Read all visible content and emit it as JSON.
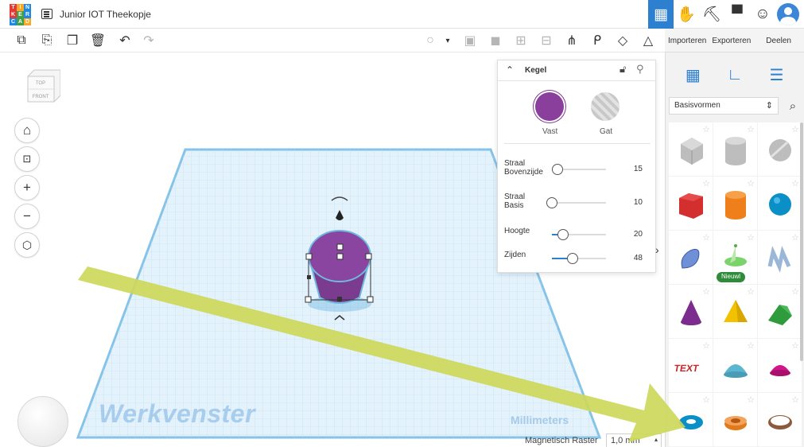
{
  "app": {
    "logo_letters": [
      "T",
      "I",
      "N",
      "K",
      "E",
      "R",
      "C",
      "A",
      "D"
    ],
    "logo_colors": [
      "#e53935",
      "#f9a825",
      "#1e88e5",
      "#e53935",
      "#43a047",
      "#1e88e5",
      "#1e88e5",
      "#43a047",
      "#f9a825"
    ],
    "design_title": "Junior IOT Theekopje"
  },
  "topbar_right": {
    "items": [
      {
        "name": "grid-view-icon",
        "glyph": "▦"
      },
      {
        "name": "hand-icon",
        "glyph": "✋"
      },
      {
        "name": "pickaxe-icon",
        "glyph": "⛏"
      },
      {
        "name": "bricks-icon",
        "glyph": "▀"
      },
      {
        "name": "add-user-icon",
        "glyph": "👤"
      }
    ]
  },
  "toolbar": {
    "left": [
      {
        "name": "copy-icon",
        "glyph": "⧉"
      },
      {
        "name": "paste-icon",
        "glyph": "📋"
      },
      {
        "name": "duplicate-icon",
        "glyph": "❐"
      },
      {
        "name": "trash-icon",
        "glyph": "🗑"
      },
      {
        "name": "undo-icon",
        "glyph": "↶"
      },
      {
        "name": "redo-icon",
        "glyph": "↷"
      }
    ],
    "right": [
      {
        "name": "bulb-icon",
        "glyph": "💡"
      },
      {
        "name": "caret-down-icon",
        "glyph": "▾"
      },
      {
        "name": "group-icon",
        "glyph": "▣"
      },
      {
        "name": "ungroup-icon",
        "glyph": "◨"
      },
      {
        "name": "align-icon",
        "glyph": "⊟"
      },
      {
        "name": "distribute-icon",
        "glyph": "≡"
      },
      {
        "name": "mirror-icon",
        "glyph": "⋔"
      },
      {
        "name": "cruise-icon",
        "glyph": "ᑭ"
      },
      {
        "name": "workplane-icon",
        "glyph": "◇"
      },
      {
        "name": "ruler-drop-icon",
        "glyph": "⚠"
      }
    ],
    "right_tabs": [
      "Importeren",
      "Exporteren",
      "Deelen"
    ]
  },
  "viewcube": {
    "top": "TOP",
    "front": "FRONT"
  },
  "workspace": {
    "label": "Werkvenster",
    "units": "Millimeters",
    "snap_label": "Magnetisch Raster",
    "snap_value": "1,0 mm"
  },
  "inspector": {
    "title": "Kegel",
    "solid_label": "Vast",
    "hole_label": "Gat",
    "solid_color": "#8a3f9c",
    "props": [
      {
        "label_1": "Straal",
        "label_2": "Bovenzijde",
        "value": "15",
        "fraction": 0.1
      },
      {
        "label_1": "Straal",
        "label_2": "Basis",
        "value": "10",
        "fraction": 0.0
      },
      {
        "label_1": "Hoogte",
        "label_2": "",
        "value": "20",
        "fraction": 0.2
      },
      {
        "label_1": "Zijden",
        "label_2": "",
        "value": "48",
        "fraction": 0.38
      }
    ]
  },
  "shapes_panel": {
    "category": "Basisvormen",
    "new_badge": "Nieuwl",
    "shapes": [
      {
        "name": "box-hole",
        "color": "#bdbdbd"
      },
      {
        "name": "cylinder-hole",
        "color": "#bdbdbd"
      },
      {
        "name": "sphere-hole",
        "color": "#bdbdbd"
      },
      {
        "name": "box",
        "color": "#d32f2f"
      },
      {
        "name": "cylinder",
        "color": "#ef7f1a"
      },
      {
        "name": "sphere",
        "color": "#0a8fc6"
      },
      {
        "name": "scribble",
        "color": "#6f8fd6"
      },
      {
        "name": "shape-generator",
        "color": "#7bd46b"
      },
      {
        "name": "text-hole",
        "color": "#9ab7d8"
      },
      {
        "name": "cone",
        "color": "#7b2c8e"
      },
      {
        "name": "pyramid",
        "color": "#f2c200"
      },
      {
        "name": "roof",
        "color": "#2e9c3c"
      },
      {
        "name": "text",
        "color": "#c62828"
      },
      {
        "name": "half-cylinder",
        "color": "#5ab6d1"
      },
      {
        "name": "paraboloid",
        "color": "#d0168a"
      },
      {
        "name": "torus",
        "color": "#0a8fc6"
      },
      {
        "name": "tube",
        "color": "#e07a1a"
      },
      {
        "name": "ring",
        "color": "#8a5a3a"
      }
    ]
  },
  "colors": {
    "accent": "#2d7fcf",
    "grid": "#d9ecf7",
    "grid_border": "#8fc8ea",
    "arrow": "#cdd85a"
  }
}
